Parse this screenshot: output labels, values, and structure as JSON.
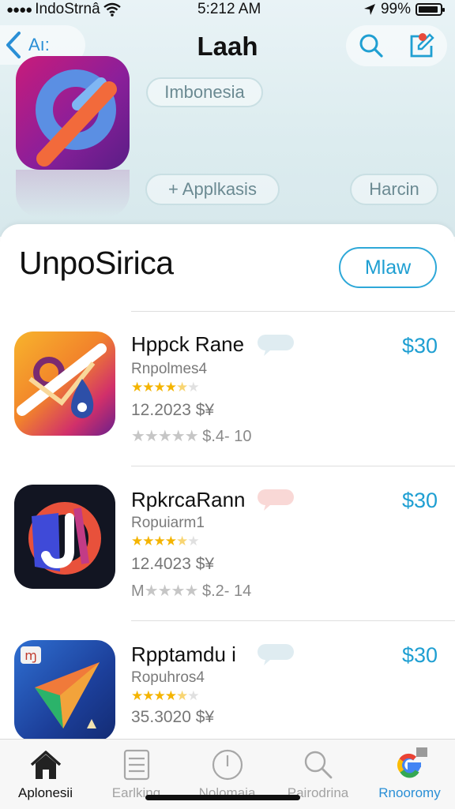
{
  "status_bar": {
    "carrier": "IndoStrnâ",
    "time": "5:212 AM",
    "battery": "99%"
  },
  "nav": {
    "back_label": "Aı:",
    "title": "Laah"
  },
  "hero": {
    "region_pill": "Imbonesia",
    "apps_pill": "+ Applkasis",
    "secondary_pill": "Harcin"
  },
  "section": {
    "title": "UnpoSirica",
    "view_button": "Mlaw"
  },
  "apps": [
    {
      "name": "Hppck Rane",
      "subtitle": "Rnpolmes4",
      "rating": 4.5,
      "date": "12.2023 $¥",
      "meta": "$.4- 10",
      "price": "$30",
      "bubble_color": "#c9dfe8"
    },
    {
      "name": "RpkrcaRann",
      "subtitle": "Ropuiarm1",
      "rating": 4.5,
      "date": "12.4023 $¥",
      "meta_prefix": "M",
      "meta": "$.2- 14",
      "price": "$30",
      "bubble_color": "#f6c8c4"
    },
    {
      "name": "Rpptamdu i",
      "subtitle": "Ropuhros4",
      "rating": 4.5,
      "date": "35.3020 $¥",
      "price": "$30",
      "bubble_color": "#c9dfe8"
    }
  ],
  "tabs": [
    {
      "label": "Aplonesii",
      "icon": "home-icon",
      "active": true
    },
    {
      "label": "Earlking",
      "icon": "list-icon",
      "active": false
    },
    {
      "label": "Nolomaia",
      "icon": "clock-icon",
      "active": false
    },
    {
      "label": "Pairodrina",
      "icon": "search-icon",
      "active": false
    },
    {
      "label": "Rnooromy",
      "icon": "google-icon",
      "active": false
    }
  ],
  "colors": {
    "accent": "#1f9fd2",
    "star": "#f4b400",
    "background_top": "#dcecef"
  }
}
